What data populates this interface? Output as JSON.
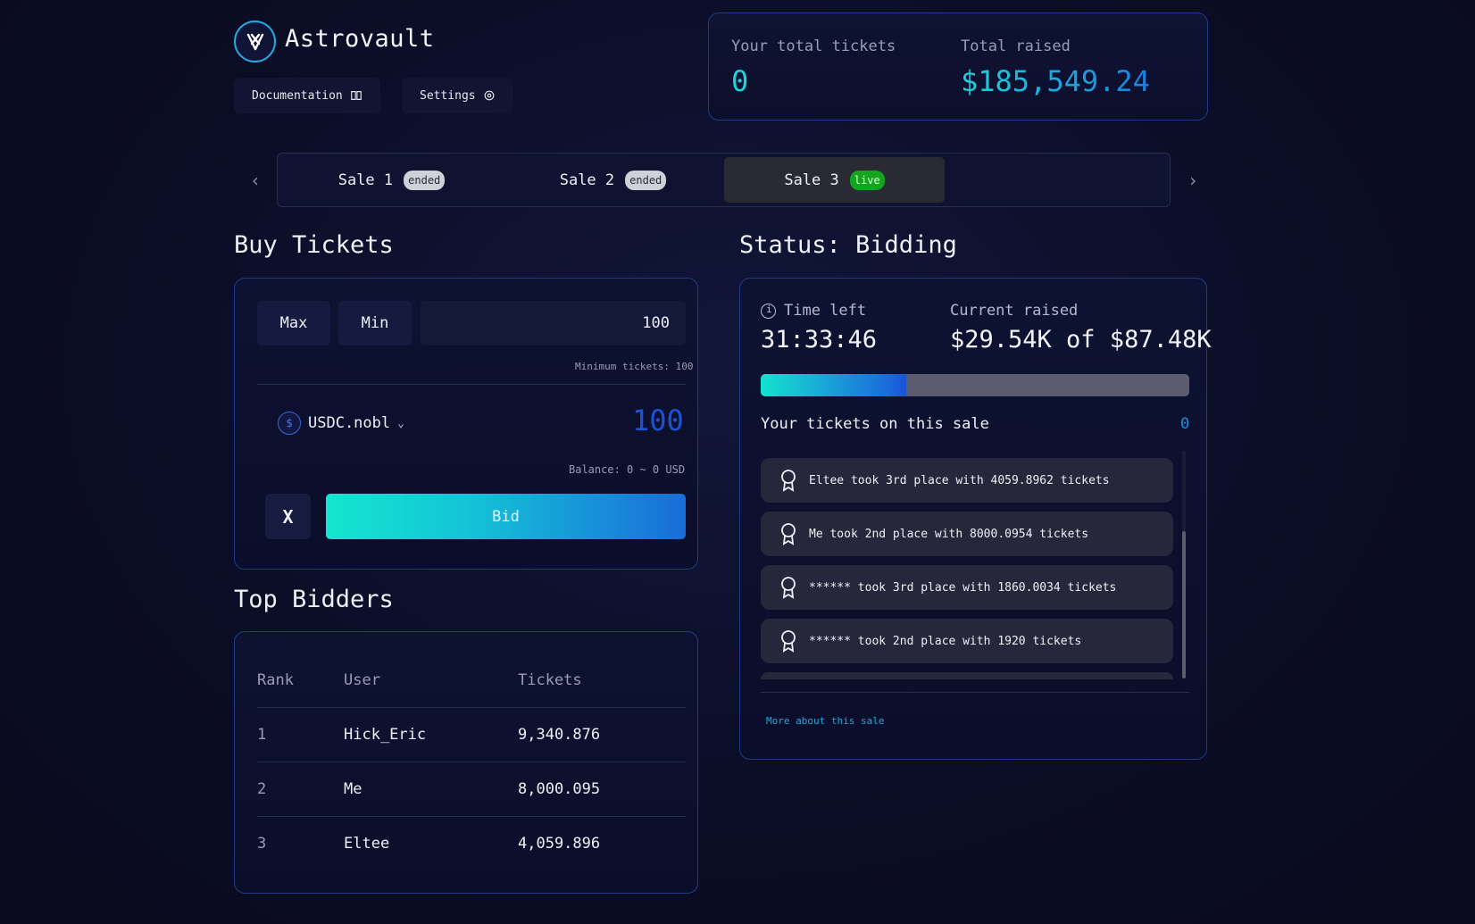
{
  "header": {
    "brand": "Astrovault",
    "docs_label": "Documentation",
    "settings_label": "Settings"
  },
  "stats": {
    "tickets_label": "Your total tickets",
    "tickets_value": "0",
    "raised_label": "Total raised",
    "raised_value": "$185,549.24"
  },
  "sales": {
    "tabs": [
      {
        "label": "Sale 1",
        "badge": "ended"
      },
      {
        "label": "Sale 2",
        "badge": "ended"
      },
      {
        "label": "Sale 3",
        "badge": "live"
      }
    ]
  },
  "buy": {
    "title": "Buy Tickets",
    "max_label": "Max",
    "min_label": "Min",
    "quantity": "100",
    "min_note": "Minimum tickets: 100",
    "token": "USDC.nobl",
    "amount": "100",
    "balance": "Balance: 0 ~ 0 USD",
    "x_label": "X",
    "bid_label": "Bid"
  },
  "bidders": {
    "title": "Top Bidders",
    "headers": [
      "Rank",
      "User",
      "Tickets"
    ],
    "rows": [
      {
        "rank": "1",
        "user": "Hick_Eric",
        "tickets": "9,340.876"
      },
      {
        "rank": "2",
        "user": "Me",
        "tickets": "8,000.095"
      },
      {
        "rank": "3",
        "user": "Eltee",
        "tickets": "4,059.896"
      }
    ]
  },
  "status": {
    "title": "Status: Bidding",
    "time_label": "Time left",
    "time_value": "31:33:46",
    "raised_label": "Current raised",
    "raised_value": "$29.54K of $87.48K",
    "progress": 0.34,
    "my_tickets_label": "Your tickets on this sale",
    "my_tickets_value": "0",
    "feed": [
      "Eltee took 3rd place with 4059.8962 tickets",
      "Me took 2nd place with 8000.0954 tickets",
      "****** took 3rd place with 1860.0034 tickets",
      "****** took 2nd place with 1920 tickets"
    ],
    "more_link": "More about this sale"
  }
}
